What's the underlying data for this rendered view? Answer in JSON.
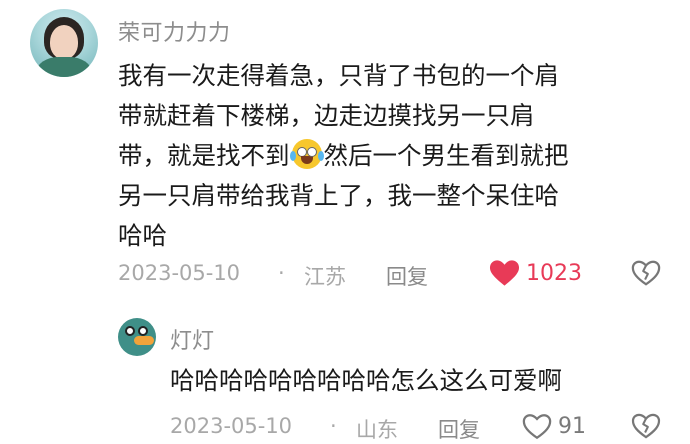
{
  "main_comment": {
    "username": "荣可力力力",
    "text_lines": [
      "我有一次走得着急，只背了书包的一个肩",
      "带就赶着下楼梯，边走边摸找另一只肩",
      "带，就是找不到",
      "然后一个男生看到就把",
      "另一只肩带给我背上了，我一整个呆住哈",
      "哈哈"
    ],
    "emoji": "crying-laughing-emoji",
    "date": "2023-05-10",
    "separator": "·",
    "location": "江苏",
    "reply_label": "回复",
    "like_count": "1023",
    "liked": true,
    "like_color": "#e83a57"
  },
  "reply": {
    "username": "灯灯",
    "text": "哈哈哈哈哈哈哈哈哈怎么这么可爱啊",
    "date": "2023-05-10",
    "separator": "·",
    "location": "山东",
    "reply_label": "回复",
    "like_count": "91",
    "liked": false
  }
}
